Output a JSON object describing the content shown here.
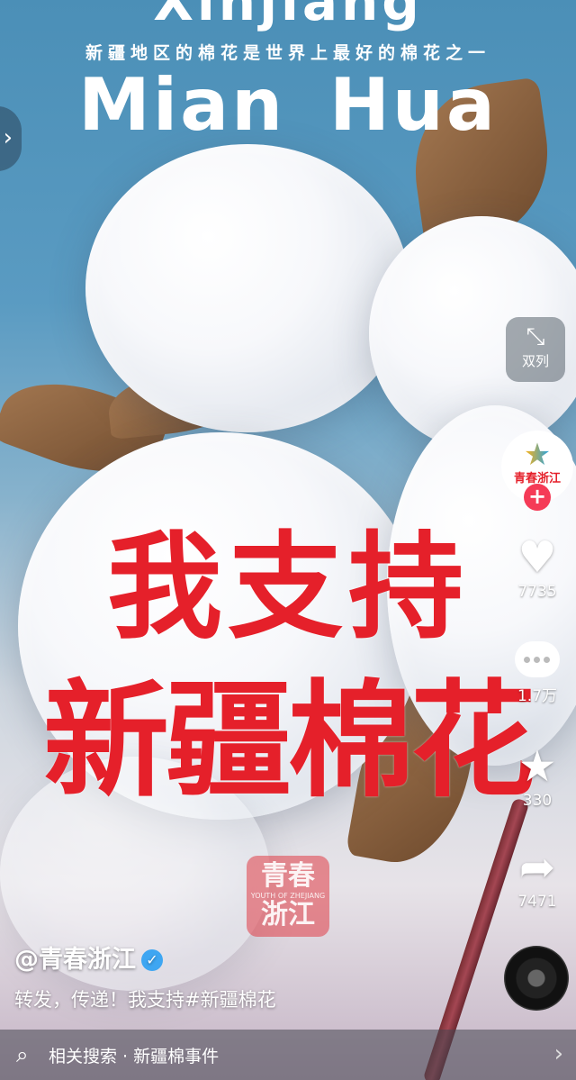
{
  "video": {
    "title_top": "Xinjiang",
    "subtitle": "新疆地区的棉花是世界上最好的棉花之一",
    "title_main": "Mian Hua",
    "slogan_line1": "我支持",
    "slogan_line2": "新疆棉花",
    "watermark_line1": "青春",
    "watermark_line2": "浙江",
    "watermark_sub": "YOUTH OF ZHEJIANG"
  },
  "actions": {
    "dual_column_icon": "collapse-arrows-icon",
    "dual_column_label": "双列",
    "avatar_label": "青春浙江",
    "follow_symbol": "+",
    "like_count": "7735",
    "comment_count": "1.7万",
    "favorite_count": "330",
    "share_count": "7471"
  },
  "caption": {
    "author": "@青春浙江",
    "verified_symbol": "✓",
    "text": "转发，传递！我支持#新疆棉花"
  },
  "search": {
    "text": "相关搜索 · 新疆棉事件"
  },
  "colors": {
    "slogan_red": "#e5202a",
    "follow_pink": "#f53b57",
    "verified_blue": "#3ea6f2"
  }
}
